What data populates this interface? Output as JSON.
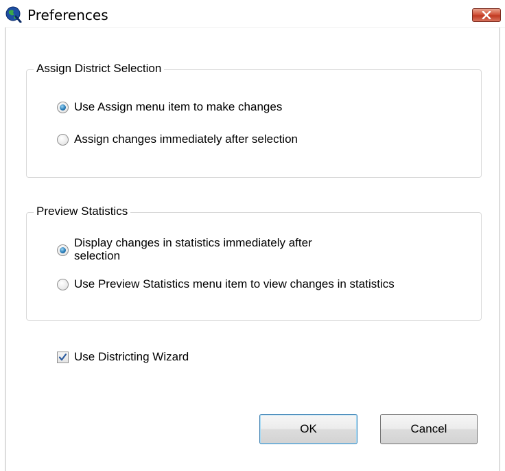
{
  "window": {
    "title": "Preferences",
    "icon": "globe-app-icon"
  },
  "assign_group": {
    "legend": "Assign District Selection",
    "options": [
      {
        "label": "Use Assign menu item to make changes",
        "checked": true
      },
      {
        "label": "Assign changes immediately after selection",
        "checked": false
      }
    ]
  },
  "preview_group": {
    "legend": "Preview Statistics",
    "options": [
      {
        "label_line1": "Display changes in statistics immediately after",
        "label_line2": "selection",
        "checked": true
      },
      {
        "label": "Use Preview Statistics menu item to view changes in statistics",
        "checked": false
      }
    ]
  },
  "wizard_checkbox": {
    "label": "Use Districting Wizard",
    "checked": true
  },
  "buttons": {
    "ok_label": "OK",
    "cancel_label": "Cancel"
  },
  "colors": {
    "close_button": "#c03a22",
    "radio_selected": "#2a7db8",
    "default_button_border": "#3c7fb1"
  }
}
